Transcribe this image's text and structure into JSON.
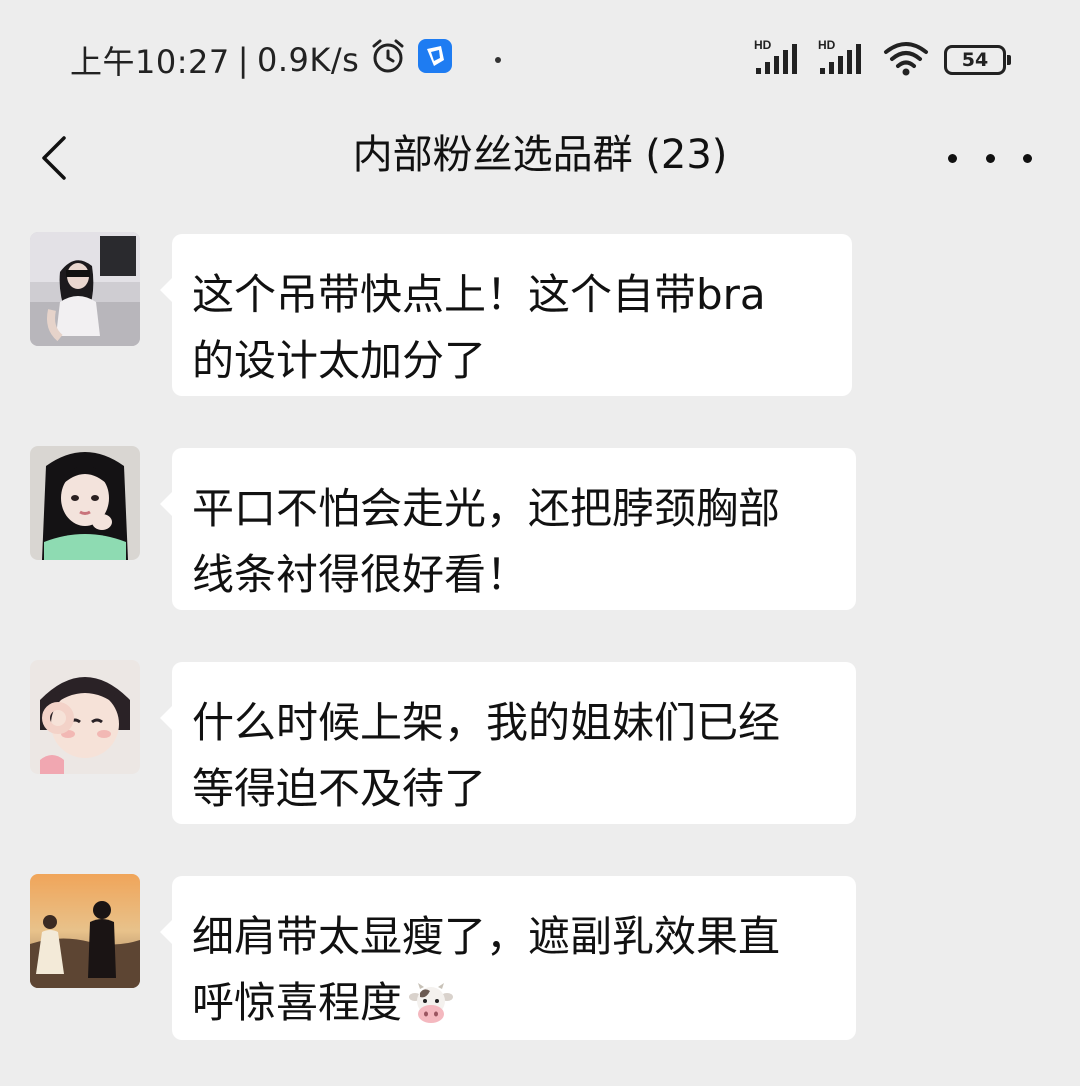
{
  "status_bar": {
    "time": "上午10:27",
    "separator": "|",
    "net_speed": "0.9K/s",
    "icons": [
      "alarm-icon",
      "app-notification-icon",
      "hd-signal-icon",
      "hd-signal-icon",
      "wifi-icon",
      "battery-icon"
    ],
    "signal_1_label": "HD",
    "signal_2_label": "HD",
    "battery": "54"
  },
  "header": {
    "title": "内部粉丝选品群 (23)",
    "back_icon": "chevron-left-icon",
    "more_icon": "more-horizontal-icon"
  },
  "messages": [
    {
      "avatar": "avatar-1",
      "lines": [
        "这个吊带快点上！这个自带bra",
        "的设计太加分了"
      ]
    },
    {
      "avatar": "avatar-2",
      "lines": [
        "平口不怕会走光，还把脖颈胸部",
        "线条衬得很好看！"
      ]
    },
    {
      "avatar": "avatar-3",
      "lines": [
        "什么时候上架，我的姐妹们已经",
        "等得迫不及待了"
      ]
    },
    {
      "avatar": "avatar-4",
      "lines": [
        "细肩带太显瘦了，遮副乳效果直",
        "呼惊喜程度"
      ],
      "trailing_emoji": "cow-face-emoji"
    }
  ],
  "colors": {
    "background": "#ededed",
    "bubble": "#ffffff",
    "text": "#111111",
    "app_icon_blue": "#1e7cf2"
  }
}
